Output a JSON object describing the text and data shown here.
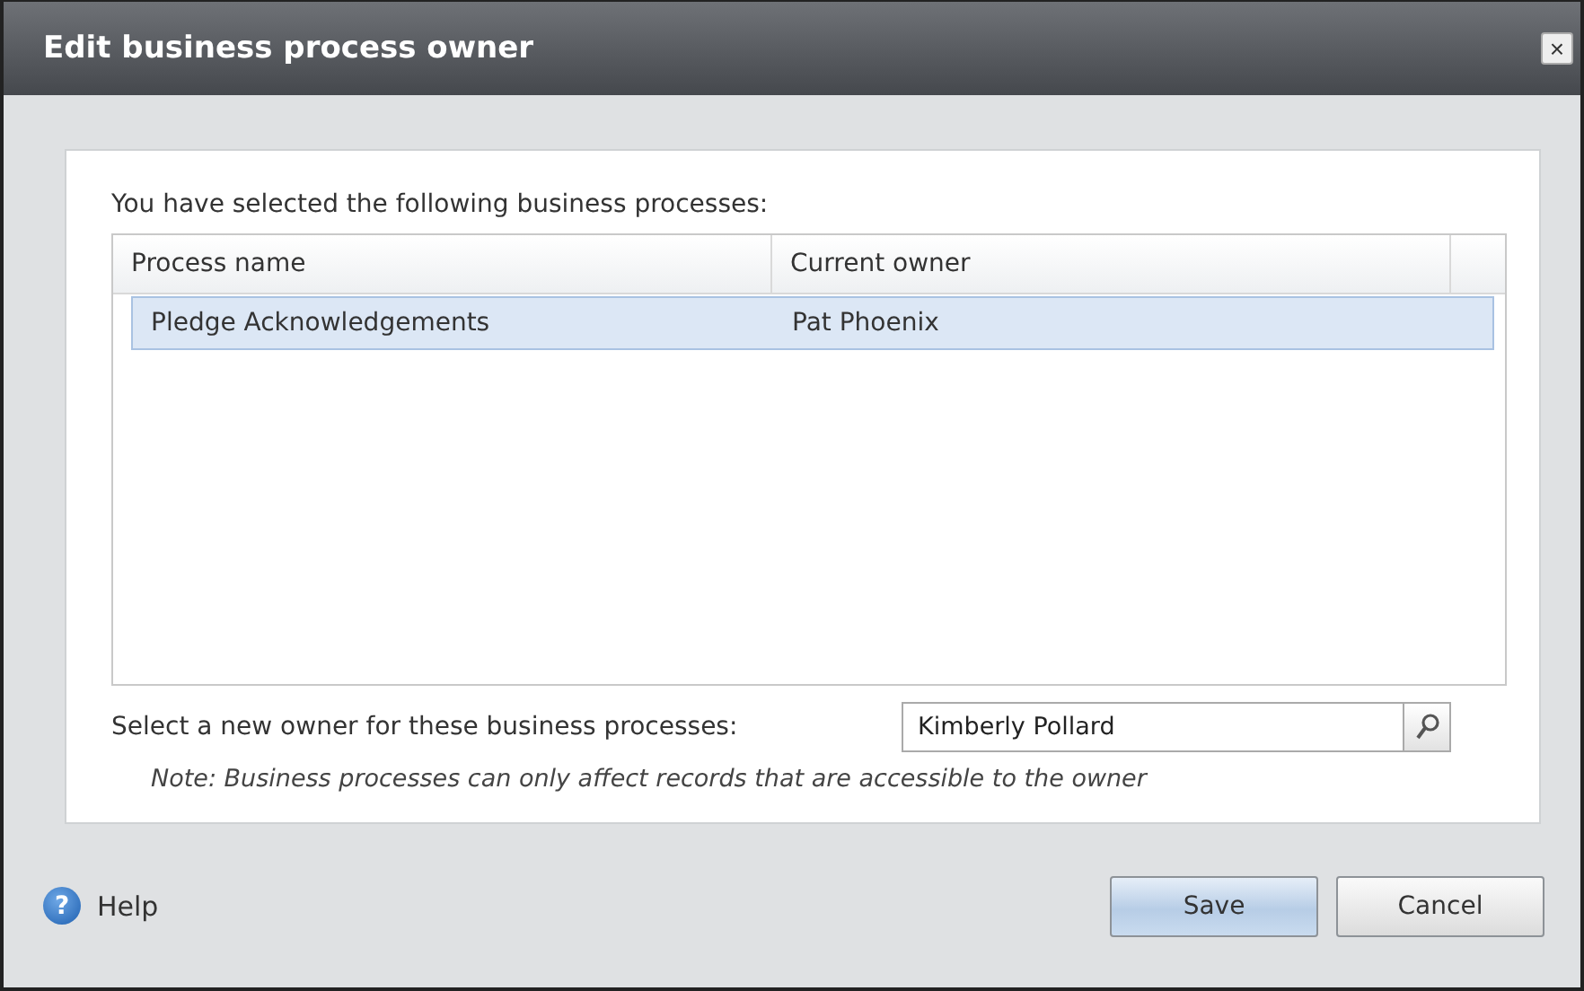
{
  "window": {
    "title": "Edit business process owner",
    "close": "×"
  },
  "intro": "You have selected the following business processes:",
  "table": {
    "columns": [
      "Process name",
      "Current owner"
    ],
    "rows": [
      {
        "cells": [
          "Pledge Acknowledgements",
          "Pat Phoenix"
        ],
        "selected": true
      }
    ]
  },
  "owner": {
    "label": "Select a new owner for these business processes:",
    "value": "Kimberly Pollard"
  },
  "note": "Note: Business processes can only affect records that are accessible to the owner",
  "footer": {
    "help": "Help",
    "help_icon": "?",
    "buttons": [
      {
        "label": "Save",
        "kind": "primary"
      },
      {
        "label": "Cancel",
        "kind": "secondary"
      }
    ]
  }
}
